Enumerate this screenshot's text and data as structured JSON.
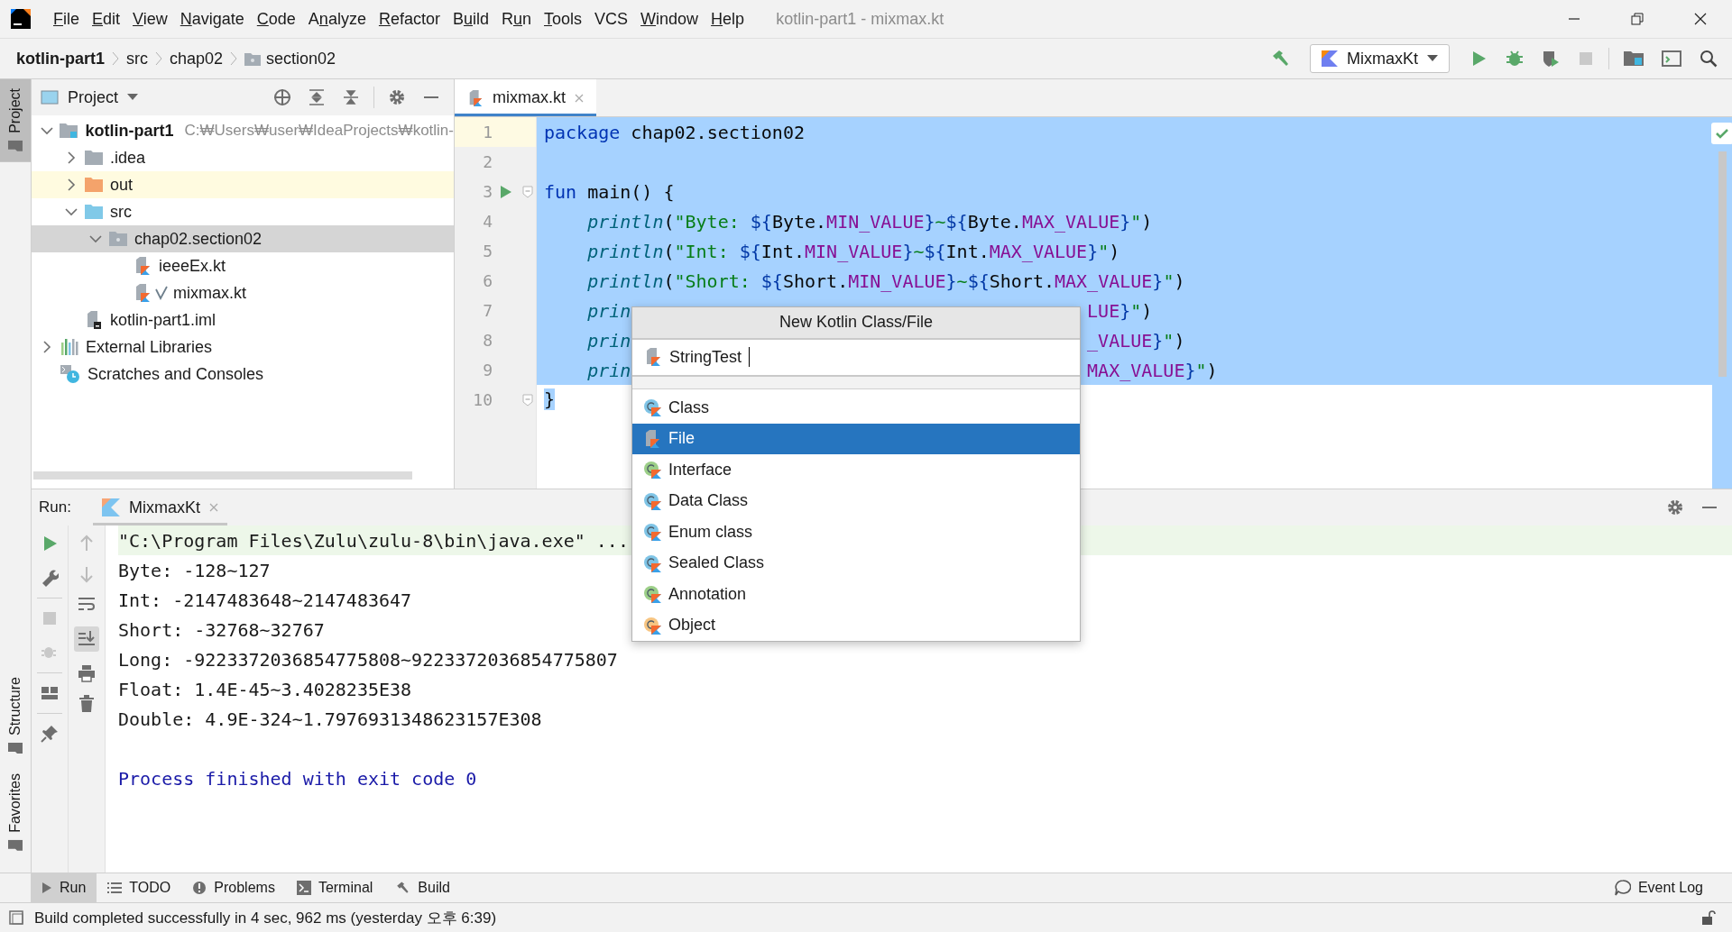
{
  "window": {
    "title": "kotlin-part1 - mixmax.kt"
  },
  "menu": [
    {
      "key": "F",
      "post": "ile"
    },
    {
      "key": "E",
      "post": "dit"
    },
    {
      "key": "V",
      "post": "iew"
    },
    {
      "key": "N",
      "post": "avigate"
    },
    {
      "key": "C",
      "post": "ode"
    },
    {
      "pre": "A",
      "key": "n",
      "post": "alyze"
    },
    {
      "key": "R",
      "post": "efactor"
    },
    {
      "pre": "B",
      "key": "u",
      "post": "ild"
    },
    {
      "pre": "R",
      "key": "u",
      "post": "n"
    },
    {
      "key": "T",
      "post": "ools"
    },
    {
      "pre": "VCS"
    },
    {
      "key": "W",
      "post": "indow"
    },
    {
      "key": "H",
      "post": "elp"
    }
  ],
  "breadcrumbs": [
    {
      "label": "kotlin-part1",
      "kind": "project"
    },
    {
      "label": "src",
      "kind": "dir"
    },
    {
      "label": "chap02",
      "kind": "dir"
    },
    {
      "label": "section02",
      "kind": "package"
    }
  ],
  "run_configuration": {
    "label": "MixmaxKt"
  },
  "side_tabs": [
    {
      "label": "Project",
      "selected": true,
      "kind": "top"
    },
    {
      "label": "Structure",
      "selected": false,
      "kind": "bottom"
    },
    {
      "label": "Favorites",
      "selected": false,
      "kind": "bottom"
    }
  ],
  "project_panel": {
    "title": "Project",
    "tree": [
      {
        "label": "kotlin-part1",
        "kind": "module",
        "path": "C:₩Users₩user₩IdeaProjects₩kotlin-",
        "expanded": true,
        "selected": false,
        "children": [
          {
            "label": ".idea",
            "kind": "folder",
            "expanded": false,
            "selected": false
          },
          {
            "label": "out",
            "kind": "excluded-folder",
            "expanded": false,
            "selected": false
          },
          {
            "label": "src",
            "kind": "source-folder",
            "expanded": true,
            "selected": false,
            "children": [
              {
                "label": "chap02.section02",
                "kind": "package",
                "expanded": true,
                "selected": true,
                "children": [
                  {
                    "label": "ieeeEx.kt",
                    "kind": "kotlin-file",
                    "selected": false,
                    "marked": false
                  },
                  {
                    "label": "mixmax.kt",
                    "kind": "kotlin-file",
                    "selected": false,
                    "marked": true
                  }
                ]
              }
            ]
          },
          {
            "label": "kotlin-part1.iml",
            "kind": "iml-file",
            "selected": false
          }
        ]
      },
      {
        "label": "External Libraries",
        "kind": "libraries",
        "expanded": false,
        "selected": false
      },
      {
        "label": "Scratches and Consoles",
        "kind": "scratches",
        "selected": false
      }
    ]
  },
  "editor": {
    "tabs": [
      {
        "label": "mixmax.kt",
        "selected": true
      }
    ],
    "lines": [
      {
        "number": "1",
        "current": true,
        "selected": true,
        "selection_end": false,
        "run_marker": false,
        "fold": false,
        "tokens": [
          {
            "kind": "keyword",
            "text": "package"
          },
          {
            "kind": "plain",
            "text": " chap02.section02"
          }
        ]
      },
      {
        "number": "2",
        "current": false,
        "selected": true,
        "selection_end": false,
        "run_marker": false,
        "fold": false
      },
      {
        "number": "3",
        "current": false,
        "selected": true,
        "selection_end": false,
        "run_marker": true,
        "fold": true,
        "tokens": [
          {
            "kind": "keyword",
            "text": "fun"
          },
          {
            "kind": "plain",
            "text": " main() {"
          }
        ]
      },
      {
        "number": "4",
        "current": false,
        "selected": true,
        "selection_end": false,
        "run_marker": false,
        "fold": false,
        "tokens": [
          {
            "kind": "function",
            "text": "    println"
          },
          {
            "kind": "plain",
            "text": "("
          },
          {
            "kind": "string",
            "text": "\"Byte: "
          },
          {
            "kind": "template",
            "text": "${"
          },
          {
            "kind": "plain",
            "text": "Byte."
          },
          {
            "kind": "constant",
            "text": "MIN_VALUE"
          },
          {
            "kind": "template",
            "text": "}"
          },
          {
            "kind": "string",
            "text": "~"
          },
          {
            "kind": "template",
            "text": "${"
          },
          {
            "kind": "plain",
            "text": "Byte."
          },
          {
            "kind": "constant",
            "text": "MAX_VALUE"
          },
          {
            "kind": "template",
            "text": "}"
          },
          {
            "kind": "string",
            "text": "\""
          },
          {
            "kind": "plain",
            "text": ")"
          }
        ]
      },
      {
        "number": "5",
        "current": false,
        "selected": true,
        "selection_end": false,
        "run_marker": false,
        "fold": false,
        "tokens": [
          {
            "kind": "function",
            "text": "    println"
          },
          {
            "kind": "plain",
            "text": "("
          },
          {
            "kind": "string",
            "text": "\"Int: "
          },
          {
            "kind": "template",
            "text": "${"
          },
          {
            "kind": "plain",
            "text": "Int."
          },
          {
            "kind": "constant",
            "text": "MIN_VALUE"
          },
          {
            "kind": "template",
            "text": "}"
          },
          {
            "kind": "string",
            "text": "~"
          },
          {
            "kind": "template",
            "text": "${"
          },
          {
            "kind": "plain",
            "text": "Int."
          },
          {
            "kind": "constant",
            "text": "MAX_VALUE"
          },
          {
            "kind": "template",
            "text": "}"
          },
          {
            "kind": "string",
            "text": "\""
          },
          {
            "kind": "plain",
            "text": ")"
          }
        ]
      },
      {
        "number": "6",
        "current": false,
        "selected": true,
        "selection_end": false,
        "run_marker": false,
        "fold": false,
        "tokens": [
          {
            "kind": "function",
            "text": "    println"
          },
          {
            "kind": "plain",
            "text": "("
          },
          {
            "kind": "string",
            "text": "\"Short: "
          },
          {
            "kind": "template",
            "text": "${"
          },
          {
            "kind": "plain",
            "text": "Short."
          },
          {
            "kind": "constant",
            "text": "MIN_VALUE"
          },
          {
            "kind": "template",
            "text": "}"
          },
          {
            "kind": "string",
            "text": "~"
          },
          {
            "kind": "template",
            "text": "${"
          },
          {
            "kind": "plain",
            "text": "Short."
          },
          {
            "kind": "constant",
            "text": "MAX_VALUE"
          },
          {
            "kind": "template",
            "text": "}"
          },
          {
            "kind": "string",
            "text": "\""
          },
          {
            "kind": "plain",
            "text": ")"
          }
        ]
      },
      {
        "number": "7",
        "current": false,
        "selected": true,
        "selection_end": false,
        "run_marker": false,
        "fold": false,
        "tokens": [
          {
            "kind": "function",
            "text": "    prin"
          }
        ],
        "tail_tokens": [
          {
            "kind": "constant",
            "text": "LUE"
          },
          {
            "kind": "template",
            "text": "}"
          },
          {
            "kind": "string",
            "text": "\""
          },
          {
            "kind": "plain",
            "text": ")"
          }
        ]
      },
      {
        "number": "8",
        "current": false,
        "selected": true,
        "selection_end": false,
        "run_marker": false,
        "fold": false,
        "tokens": [
          {
            "kind": "function",
            "text": "    prin"
          }
        ],
        "tail_tokens": [
          {
            "kind": "constant",
            "text": "_VALUE"
          },
          {
            "kind": "template",
            "text": "}"
          },
          {
            "kind": "string",
            "text": "\""
          },
          {
            "kind": "plain",
            "text": ")"
          }
        ]
      },
      {
        "number": "9",
        "current": false,
        "selected": true,
        "selection_end": false,
        "run_marker": false,
        "fold": false,
        "tokens": [
          {
            "kind": "function",
            "text": "    prin"
          }
        ],
        "tail_tokens": [
          {
            "kind": "constant",
            "text": "MAX_VALUE"
          },
          {
            "kind": "template",
            "text": "}"
          },
          {
            "kind": "string",
            "text": "\""
          },
          {
            "kind": "plain",
            "text": ")"
          }
        ]
      },
      {
        "number": "10",
        "current": false,
        "selected": true,
        "selection_end": true,
        "run_marker": false,
        "fold": true,
        "tokens": [
          {
            "kind": "plain",
            "text": "}"
          }
        ]
      }
    ]
  },
  "dialog": {
    "title": "New Kotlin Class/File",
    "value": "StringTest",
    "items": [
      {
        "label": "Class",
        "kind": "class",
        "selected": false
      },
      {
        "label": "File",
        "kind": "file",
        "selected": true
      },
      {
        "label": "Interface",
        "kind": "interface",
        "selected": false
      },
      {
        "label": "Data Class",
        "kind": "class",
        "selected": false
      },
      {
        "label": "Enum class",
        "kind": "class",
        "selected": false
      },
      {
        "label": "Sealed Class",
        "kind": "class",
        "selected": false
      },
      {
        "label": "Annotation",
        "kind": "annotation",
        "selected": false
      },
      {
        "label": "Object",
        "kind": "object",
        "selected": false
      }
    ]
  },
  "run_panel": {
    "label": "Run:",
    "tabs": [
      {
        "label": "MixmaxKt",
        "selected": true
      }
    ],
    "console": [
      {
        "kind": "command",
        "text": "\"C:\\Program Files\\Zulu\\zulu-8\\bin\\java.exe\" ..."
      },
      {
        "kind": "output",
        "text": "Byte: -128~127"
      },
      {
        "kind": "output",
        "text": "Int: -2147483648~2147483647"
      },
      {
        "kind": "output",
        "text": "Short: -32768~32767"
      },
      {
        "kind": "output",
        "text": "Long: -9223372036854775808~9223372036854775807"
      },
      {
        "kind": "output",
        "text": "Float: 1.4E-45~3.4028235E38"
      },
      {
        "kind": "output",
        "text": "Double: 4.9E-324~1.7976931348623157E308"
      },
      {
        "kind": "blank"
      },
      {
        "kind": "exit",
        "text": "Process finished with exit code 0"
      }
    ]
  },
  "tool_tabs": [
    {
      "label": "Run",
      "kind": "run",
      "selected": true
    },
    {
      "label": "TODO",
      "kind": "todo",
      "selected": false
    },
    {
      "label": "Problems",
      "kind": "problems",
      "selected": false
    },
    {
      "label": "Terminal",
      "kind": "terminal",
      "selected": false
    },
    {
      "label": "Build",
      "kind": "build",
      "selected": false
    }
  ],
  "event_log": {
    "label": "Event Log"
  },
  "status_bar": {
    "message": "Build completed successfully in 4 sec, 962 ms (yesterday 오후 6:39)"
  }
}
